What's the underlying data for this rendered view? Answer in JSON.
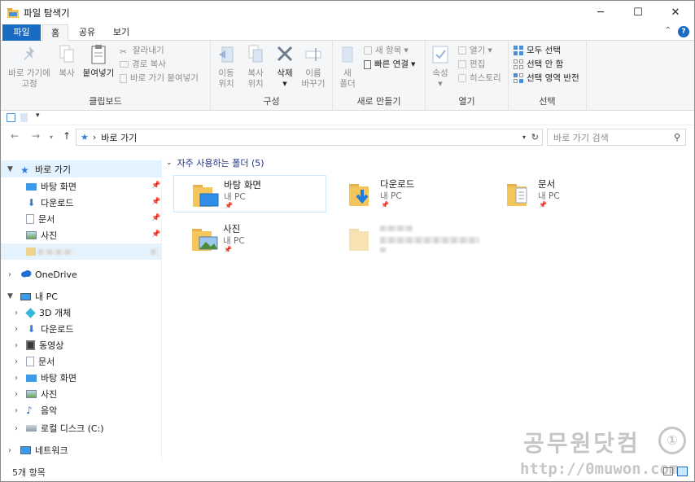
{
  "window": {
    "title": "파일 탐색기",
    "minimize": "─",
    "maximize": "☐",
    "close": "✕"
  },
  "tabs": {
    "file": "파일",
    "home": "홈",
    "share": "공유",
    "view": "보기",
    "collapse": "⌃",
    "help": "?"
  },
  "ribbon": {
    "clipboard": {
      "label": "클립보드",
      "pin_quick": [
        "바로 가기에",
        "고정"
      ],
      "copy": "복사",
      "paste": "붙여넣기",
      "cut": "잘라내기",
      "copy_path": "경로 복사",
      "paste_shortcut": "바로 가기 붙여넣기"
    },
    "organize": {
      "label": "구성",
      "move_to": [
        "이동",
        "위치"
      ],
      "copy_to": [
        "복사",
        "위치"
      ],
      "delete": "삭제",
      "rename": [
        "이름",
        "바꾸기"
      ]
    },
    "new": {
      "label": "새로 만들기",
      "new_folder": [
        "새",
        "폴더"
      ],
      "new_item": "새 항목",
      "easy_access": "빠른 연결"
    },
    "open": {
      "label": "열기",
      "properties": "속성",
      "open": "열기",
      "edit": "편집",
      "history": "히스토리"
    },
    "select": {
      "label": "선택",
      "select_all": "모두 선택",
      "select_none": "선택 안 함",
      "invert": "선택 영역 반전"
    }
  },
  "address": {
    "path": "바로 가기",
    "separator": "›",
    "search_placeholder": "바로 가기 검색"
  },
  "nav": {
    "quick_access": "바로 가기",
    "quick_items": [
      "바탕 화면",
      "다운로드",
      "문서",
      "사진"
    ],
    "onedrive": "OneDrive",
    "this_pc": "내 PC",
    "pc_items": [
      "3D 개체",
      "다운로드",
      "동영상",
      "문서",
      "바탕 화면",
      "사진",
      "음악",
      "로컬 디스크 (C:)"
    ],
    "network": "네트워크"
  },
  "content": {
    "group_header": "자주 사용하는 폴더 (5)",
    "folders": [
      {
        "name": "바탕 화면",
        "location": "내 PC"
      },
      {
        "name": "다운로드",
        "location": "내 PC"
      },
      {
        "name": "문서",
        "location": "내 PC"
      },
      {
        "name": "사진",
        "location": "내 PC"
      }
    ]
  },
  "status": {
    "count": "5개 항목"
  },
  "watermark": {
    "text": "공무원닷컴",
    "url": "http://0muwon.com"
  },
  "colors": {
    "accent": "#1a6bc4",
    "selection": "#cce8ff",
    "folder": "#f4c55b",
    "header": "#1e3287"
  }
}
